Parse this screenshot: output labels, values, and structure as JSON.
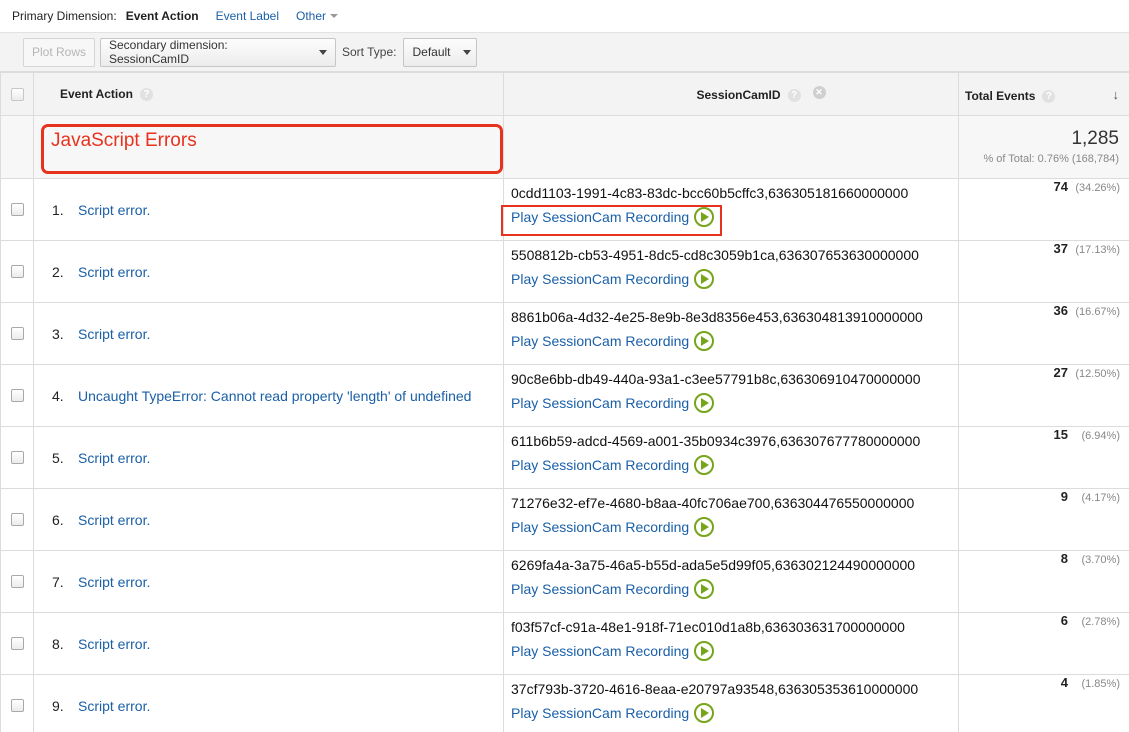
{
  "primary": {
    "label": "Primary Dimension:",
    "active": "Event Action",
    "option": "Event Label",
    "other": "Other"
  },
  "toolbar": {
    "plot_rows": "Plot Rows",
    "secondary": "Secondary dimension: SessionCamID",
    "sort_label": "Sort Type:",
    "sort_value": "Default"
  },
  "table": {
    "headers": {
      "event_action": "Event Action",
      "session_cam_id": "SessionCamID",
      "total_events": "Total Events"
    },
    "summary": {
      "label": "JavaScript Errors",
      "total": "1,285",
      "pct_of_total": "% of Total: 0.76% (168,784)"
    },
    "play_label": "Play SessionCam Recording",
    "rows": [
      {
        "num": "1.",
        "action": "Script error.",
        "sid": "0cdd1103-1991-4c83-83dc-bcc60b5cffc3,636305181660000000",
        "value": "74",
        "pct": "(34.26%)"
      },
      {
        "num": "2.",
        "action": "Script error.",
        "sid": "5508812b-cb53-4951-8dc5-cd8c3059b1ca,636307653630000000",
        "value": "37",
        "pct": "(17.13%)"
      },
      {
        "num": "3.",
        "action": "Script error.",
        "sid": "8861b06a-4d32-4e25-8e9b-8e3d8356e453,636304813910000000",
        "value": "36",
        "pct": "(16.67%)"
      },
      {
        "num": "4.",
        "action": "Uncaught TypeError: Cannot read property 'length' of undefined",
        "sid": "90c8e6bb-db49-440a-93a1-c3ee57791b8c,636306910470000000",
        "value": "27",
        "pct": "(12.50%)"
      },
      {
        "num": "5.",
        "action": "Script error.",
        "sid": "611b6b59-adcd-4569-a001-35b0934c3976,636307677780000000",
        "value": "15",
        "pct": "(6.94%)"
      },
      {
        "num": "6.",
        "action": "Script error.",
        "sid": "71276e32-ef7e-4680-b8aa-40fc706ae700,636304476550000000",
        "value": "9",
        "pct": "(4.17%)"
      },
      {
        "num": "7.",
        "action": "Script error.",
        "sid": "6269fa4a-3a75-46a5-b55d-ada5e5d99f05,636302124490000000",
        "value": "8",
        "pct": "(3.70%)"
      },
      {
        "num": "8.",
        "action": "Script error.",
        "sid": "f03f57cf-c91a-48e1-918f-71ec010d1a8b,636303631700000000",
        "value": "6",
        "pct": "(2.78%)"
      },
      {
        "num": "9.",
        "action": "Script error.",
        "sid": "37cf793b-3720-4616-8eaa-e20797a93548,636305353610000000",
        "value": "4",
        "pct": "(1.85%)"
      }
    ]
  }
}
